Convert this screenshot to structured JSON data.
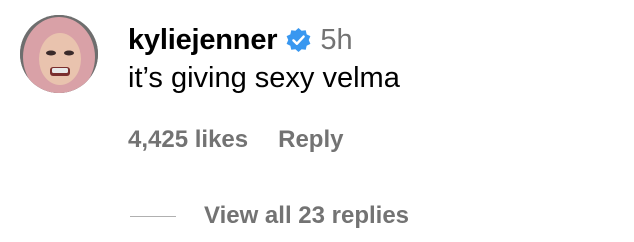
{
  "comment": {
    "avatar_icon": "profile-photo",
    "username": "kyliejenner",
    "verified_icon": "verified-badge-icon",
    "verified_color": "#3897f0",
    "timestamp": "5h",
    "text": "it’s giving sexy velma",
    "likes": "4,425 likes",
    "reply_label": "Reply",
    "view_replies_label": "View all 23 replies"
  },
  "colors": {
    "primary_text": "#000000",
    "secondary_text": "#737373",
    "divider": "#b0b0b0",
    "background": "#ffffff"
  }
}
